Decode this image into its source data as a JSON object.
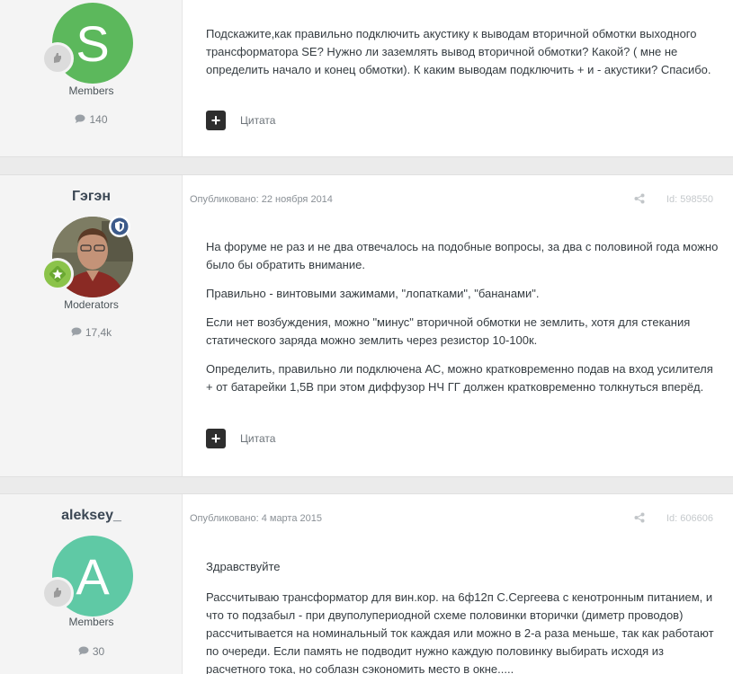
{
  "posts": [
    {
      "author": "",
      "avatar_letter": "S",
      "avatar_color": "#5cb85c",
      "group": "Members",
      "post_count": "140",
      "date": "",
      "post_id": "",
      "paragraphs": [
        "Подскажите,как правильно подключить акустику к выводам вторичной обмотки выходного трансформатора SE? Нужно ли заземлять вывод вторичной обмотки? Какой? ( мне не определить начало и конец обмотки). К каким выводам подключить + и - акустики? Спасибо."
      ],
      "quote_label": "Цитата",
      "react_label": "+"
    },
    {
      "author": "Гэгэн",
      "avatar_type": "photo",
      "group": "Moderators",
      "post_count": "17,4k",
      "date": "Опубликовано: 22 ноября 2014",
      "post_id": "Id: 598550",
      "paragraphs": [
        "На форуме не раз и не два отвечалось на подобные вопросы, за два с половиной года можно было бы обратить внимание.",
        "Правильно - винтовыми зажимами, \"лопатками\", \"бананами\".",
        "Если нет возбуждения, можно \"минус\" вторичной обмотки не землить, хотя для стекания статического заряда можно землить через резистор 10-100к.",
        "Определить, правильно ли подключена АС, можно кратковременно подав на вход усилителя + от батарейки 1,5В при этом диффузор НЧ ГГ должен кратковременно толкнуться вперёд."
      ],
      "quote_label": "Цитата",
      "react_label": "+"
    },
    {
      "author": "aleksey_",
      "avatar_letter": "A",
      "avatar_color": "#5fc9a5",
      "group": "Members",
      "post_count": "30",
      "date": "Опубликовано: 4 марта 2015",
      "post_id": "Id: 606606",
      "paragraphs": [
        "Здравствуйте",
        "Рассчитываю трансформатор для вин.кор. на 6ф12п С.Сергеева с кенотронным питанием, и что то подзабыл - при двуполупериодной схеме половинки вторички (диметр проводов) рассчитывается на номинальный ток каждая или можно в 2-а раза меньше, так как работают по очереди. Если память не подводит нужно каждую половинку выбирать исходя из расчетного тока, но соблазн сэкономить место в окне....."
      ]
    }
  ],
  "colors": {
    "badge_moderator": "#3c5a8a",
    "badge_star": "#8bc34a"
  }
}
